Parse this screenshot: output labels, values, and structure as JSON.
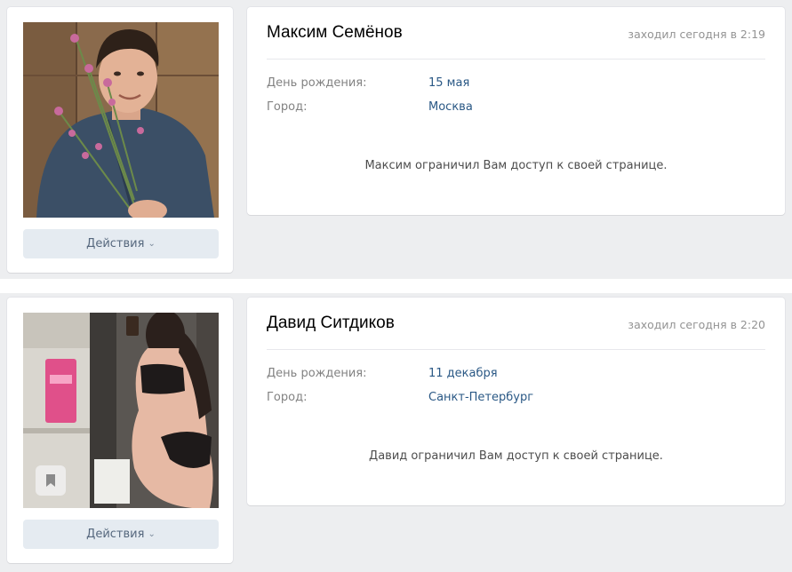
{
  "profiles": [
    {
      "name": "Максим Семёнов",
      "last_seen": "заходил сегодня в 2:19",
      "birthday_label": "День рождения:",
      "birthday_value": "15 мая",
      "city_label": "Город:",
      "city_value": "Москва",
      "notice": "Максим ограничил Вам доступ к своей странице.",
      "actions_label": "Действия",
      "photo_desc": "man-with-flowers-photo"
    },
    {
      "name": "Давид Ситдиков",
      "last_seen": "заходил сегодня в 2:20",
      "birthday_label": "День рождения:",
      "birthday_value": "11 декабря",
      "city_label": "Город:",
      "city_value": "Санкт-Петербург",
      "notice": "Давид ограничил Вам доступ к своей странице.",
      "actions_label": "Действия",
      "photo_desc": "mirror-selfie-photo"
    }
  ],
  "colors": {
    "page_bg": "#edeef0",
    "link": "#2a5885",
    "button_bg": "#e5ebf1",
    "button_text": "#55677d",
    "muted": "#939393"
  },
  "icons": {
    "chevron": "chevron-down-icon",
    "bookmark": "bookmark-icon"
  }
}
